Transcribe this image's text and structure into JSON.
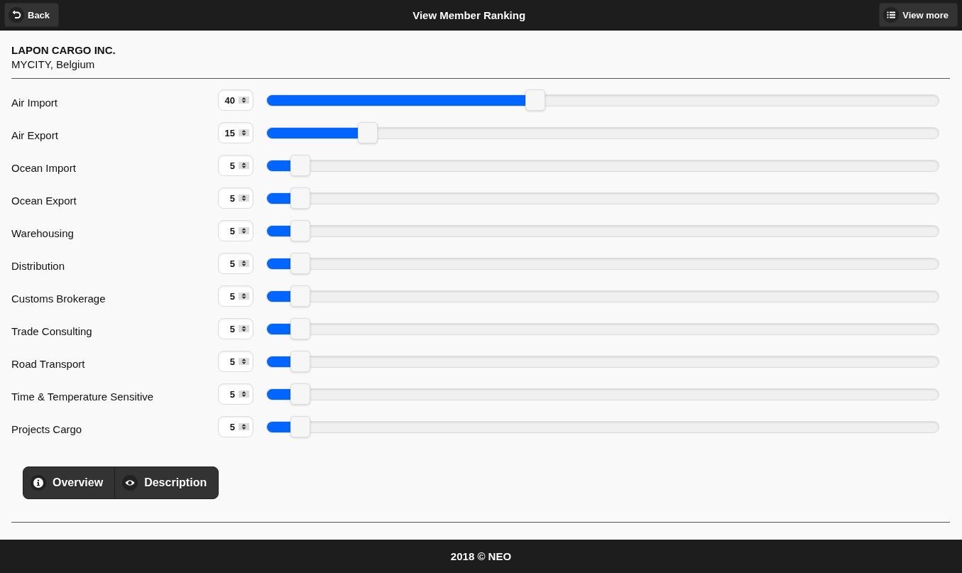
{
  "header": {
    "back_button": "Back",
    "title": "View Member Ranking",
    "view_more_button": "View more"
  },
  "company": {
    "name": "LAPON CARGO INC.",
    "location": "MYCITY, Belgium"
  },
  "rankings": [
    {
      "label": "Air Import",
      "value": "40",
      "level": 0.4
    },
    {
      "label": "Air Export",
      "value": "15",
      "level": 0.15
    },
    {
      "label": "Ocean Import",
      "value": "5",
      "level": 0.05
    },
    {
      "label": "Ocean Export",
      "value": "5",
      "level": 0.05
    },
    {
      "label": "Warehousing",
      "value": "5",
      "level": 0.05
    },
    {
      "label": "Distribution",
      "value": "5",
      "level": 0.05
    },
    {
      "label": "Customs Brokerage",
      "value": "5",
      "level": 0.05
    },
    {
      "label": "Trade Consulting",
      "value": "5",
      "level": 0.05
    },
    {
      "label": "Road Transport",
      "value": "5",
      "level": 0.05
    },
    {
      "label": "Time & Temperature Sensitive",
      "value": "5",
      "level": 0.05
    },
    {
      "label": "Projects Cargo",
      "value": "5",
      "level": 0.05
    }
  ],
  "actions": [
    {
      "label": "Overview"
    },
    {
      "label": "Description"
    }
  ],
  "footer": "2018 © NEO"
}
